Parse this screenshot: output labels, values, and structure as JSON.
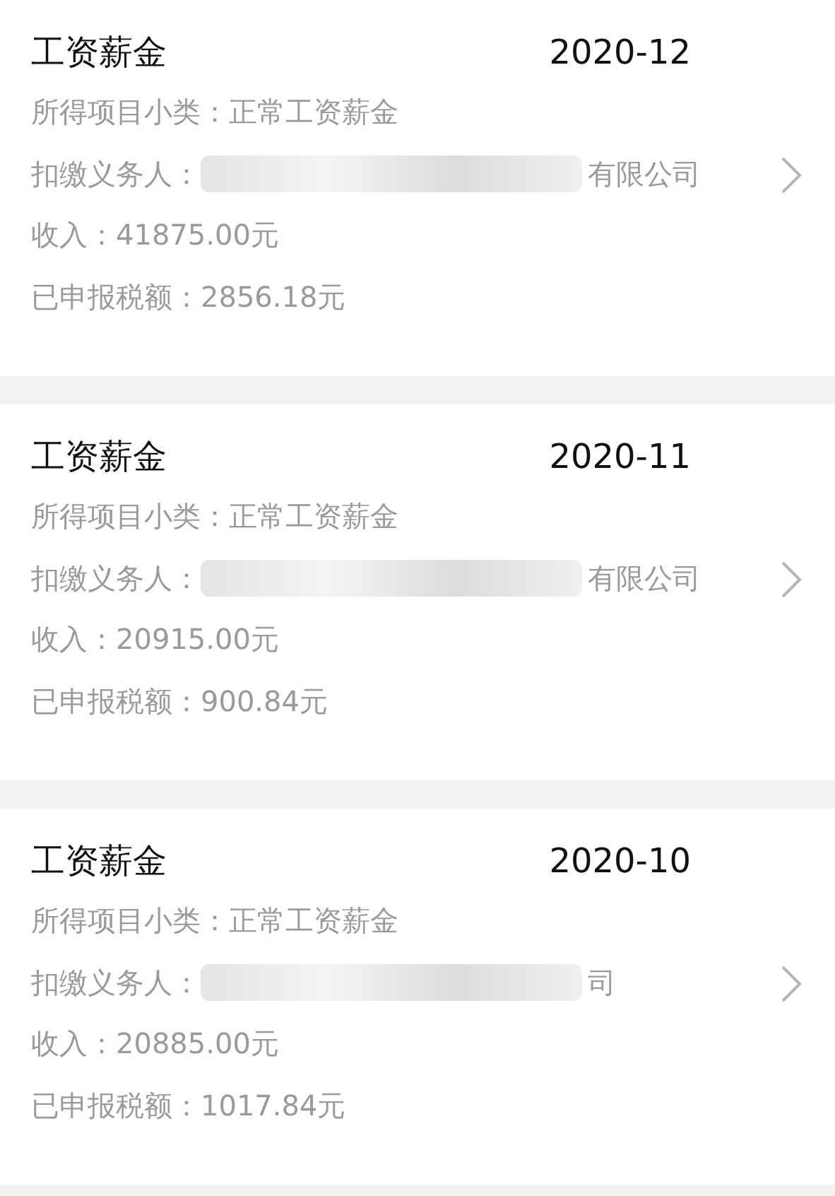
{
  "records": [
    {
      "title": "工资薪金",
      "period": "2020-12",
      "subcategory_label": "所得项目小类：",
      "subcategory": "正常工资薪金",
      "payer_label": "扣缴义务人：",
      "payer_visible": "有限公司",
      "income_label": "收入：",
      "income": "41875.00元",
      "tax_label": "已申报税额：",
      "tax": "2856.18元"
    },
    {
      "title": "工资薪金",
      "period": "2020-11",
      "subcategory_label": "所得项目小类：",
      "subcategory": "正常工资薪金",
      "payer_label": "扣缴义务人：",
      "payer_visible": "有限公司",
      "income_label": "收入：",
      "income": "20915.00元",
      "tax_label": "已申报税额：",
      "tax": "900.84元"
    },
    {
      "title": "工资薪金",
      "period": "2020-10",
      "subcategory_label": "所得项目小类：",
      "subcategory": "正常工资薪金",
      "payer_label": "扣缴义务人：",
      "payer_visible": "司",
      "income_label": "收入：",
      "income": "20885.00元",
      "tax_label": "已申报税额：",
      "tax": "1017.84元"
    }
  ]
}
